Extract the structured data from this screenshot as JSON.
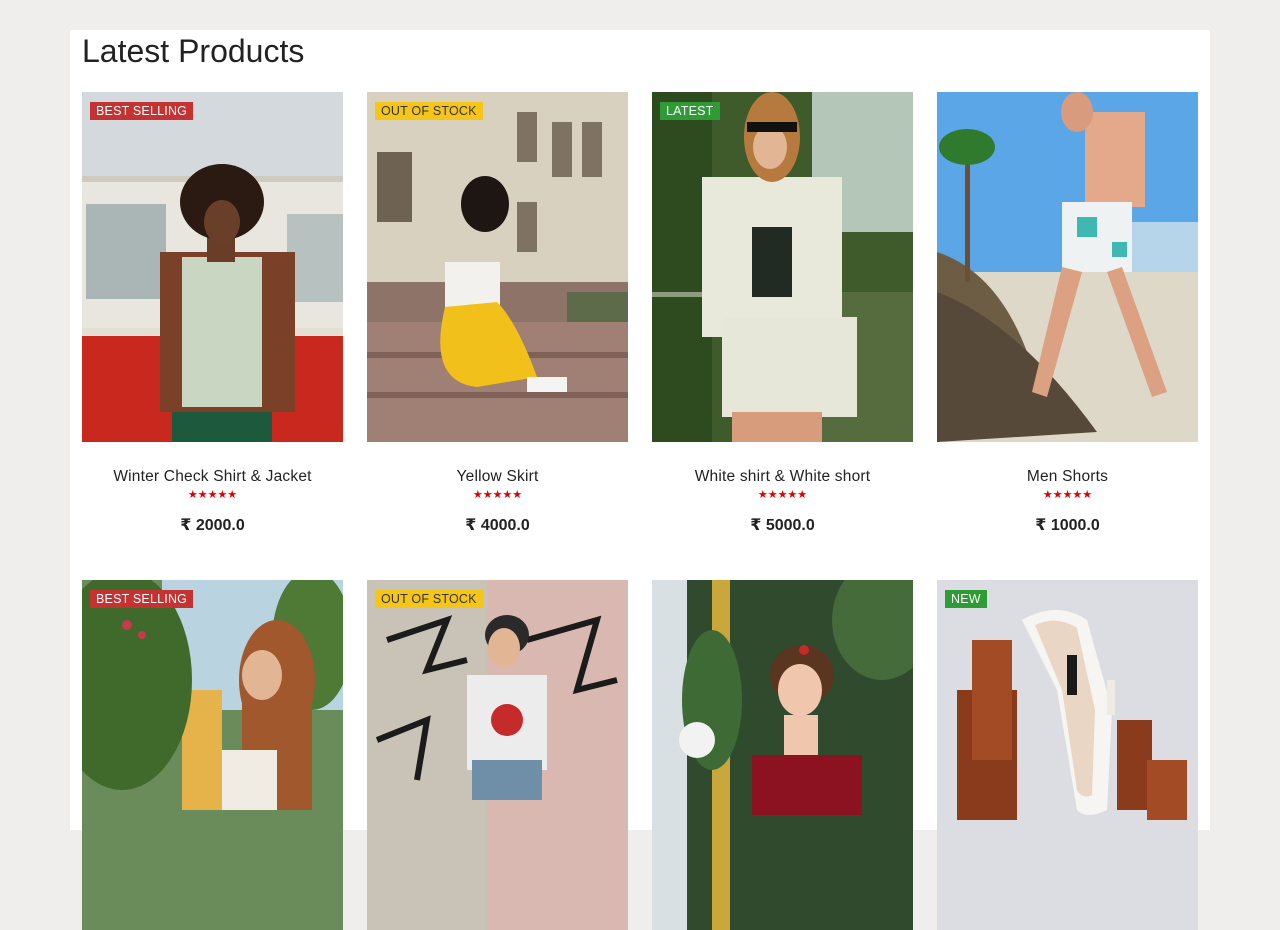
{
  "section": {
    "title": "Latest Products"
  },
  "colors": {
    "badge_best": "#c43331",
    "badge_stock": "#f5c518",
    "badge_latest": "#2e9b34",
    "stars": "#e10000"
  },
  "products": [
    {
      "badge": "BEST SELLING",
      "badge_style": "red",
      "name": "Winter Check Shirt & Jacket",
      "stars": "★★★★★",
      "price": "₹ 2000.0",
      "image": "man-in-plaid-jacket-by-van"
    },
    {
      "badge": "OUT OF STOCK",
      "badge_style": "yellow",
      "name": "Yellow Skirt",
      "stars": "★★★★★",
      "price": "₹ 4000.0",
      "image": "woman-yellow-skirt-on-steps"
    },
    {
      "badge": "LATEST",
      "badge_style": "green",
      "name": "White shirt & White short",
      "stars": "★★★★★",
      "price": "₹ 5000.0",
      "image": "woman-striped-white-suit"
    },
    {
      "badge": "",
      "badge_style": "",
      "name": "Men Shorts",
      "stars": "★★★★★",
      "price": "₹ 1000.0",
      "image": "man-beach-shorts"
    },
    {
      "badge": "BEST SELLING",
      "badge_style": "red",
      "image": "woman-long-hair-foliage"
    },
    {
      "badge": "OUT OF STOCK",
      "badge_style": "yellow",
      "image": "girl-graffiti-wall"
    },
    {
      "badge": "",
      "badge_style": "",
      "image": "woman-red-dress-garden"
    },
    {
      "badge": "NEW",
      "badge_style": "green",
      "image": "white-high-heel-shoe"
    }
  ]
}
